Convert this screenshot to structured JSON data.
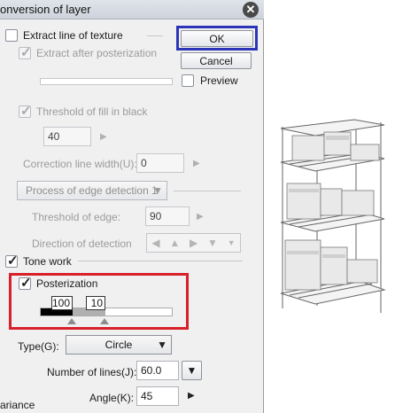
{
  "window": {
    "title": "onversion of layer"
  },
  "buttons": {
    "ok": "OK",
    "cancel": "Cancel"
  },
  "preview": {
    "label": "Preview",
    "checked": false
  },
  "extract_line": {
    "label": "Extract line of texture",
    "checked": false
  },
  "extract_after": {
    "label": "Extract after posterization",
    "checked": true
  },
  "threshold_fill": {
    "label": "Threshold of fill in black",
    "checked": true,
    "value": "40"
  },
  "correction": {
    "label": "Correction line width(U):",
    "value": "0"
  },
  "edge_process": {
    "value": "Process of edge detection 1"
  },
  "threshold_edge": {
    "label": "Threshold of edge:",
    "value": "90"
  },
  "direction": {
    "label": "Direction of detection"
  },
  "tone_work": {
    "label": "Tone work",
    "checked": true
  },
  "posterization": {
    "label": "Posterization",
    "checked": true,
    "level1": "100",
    "level2": "10"
  },
  "type": {
    "label": "Type(G):",
    "value": "Circle"
  },
  "lines": {
    "label": "Number of lines(J):",
    "value": "60.0"
  },
  "angle": {
    "label": "Angle(K):",
    "value": "45"
  },
  "variance": {
    "label": "ariance"
  },
  "icons": {
    "close": "close-icon",
    "dropdown": "chevron-down-icon",
    "spin": "triangle-right-icon",
    "preview_image": "wire-shelving-illustration"
  },
  "colors": {
    "ok_highlight": "#2c35b8",
    "posterization_highlight": "#d8202a"
  }
}
